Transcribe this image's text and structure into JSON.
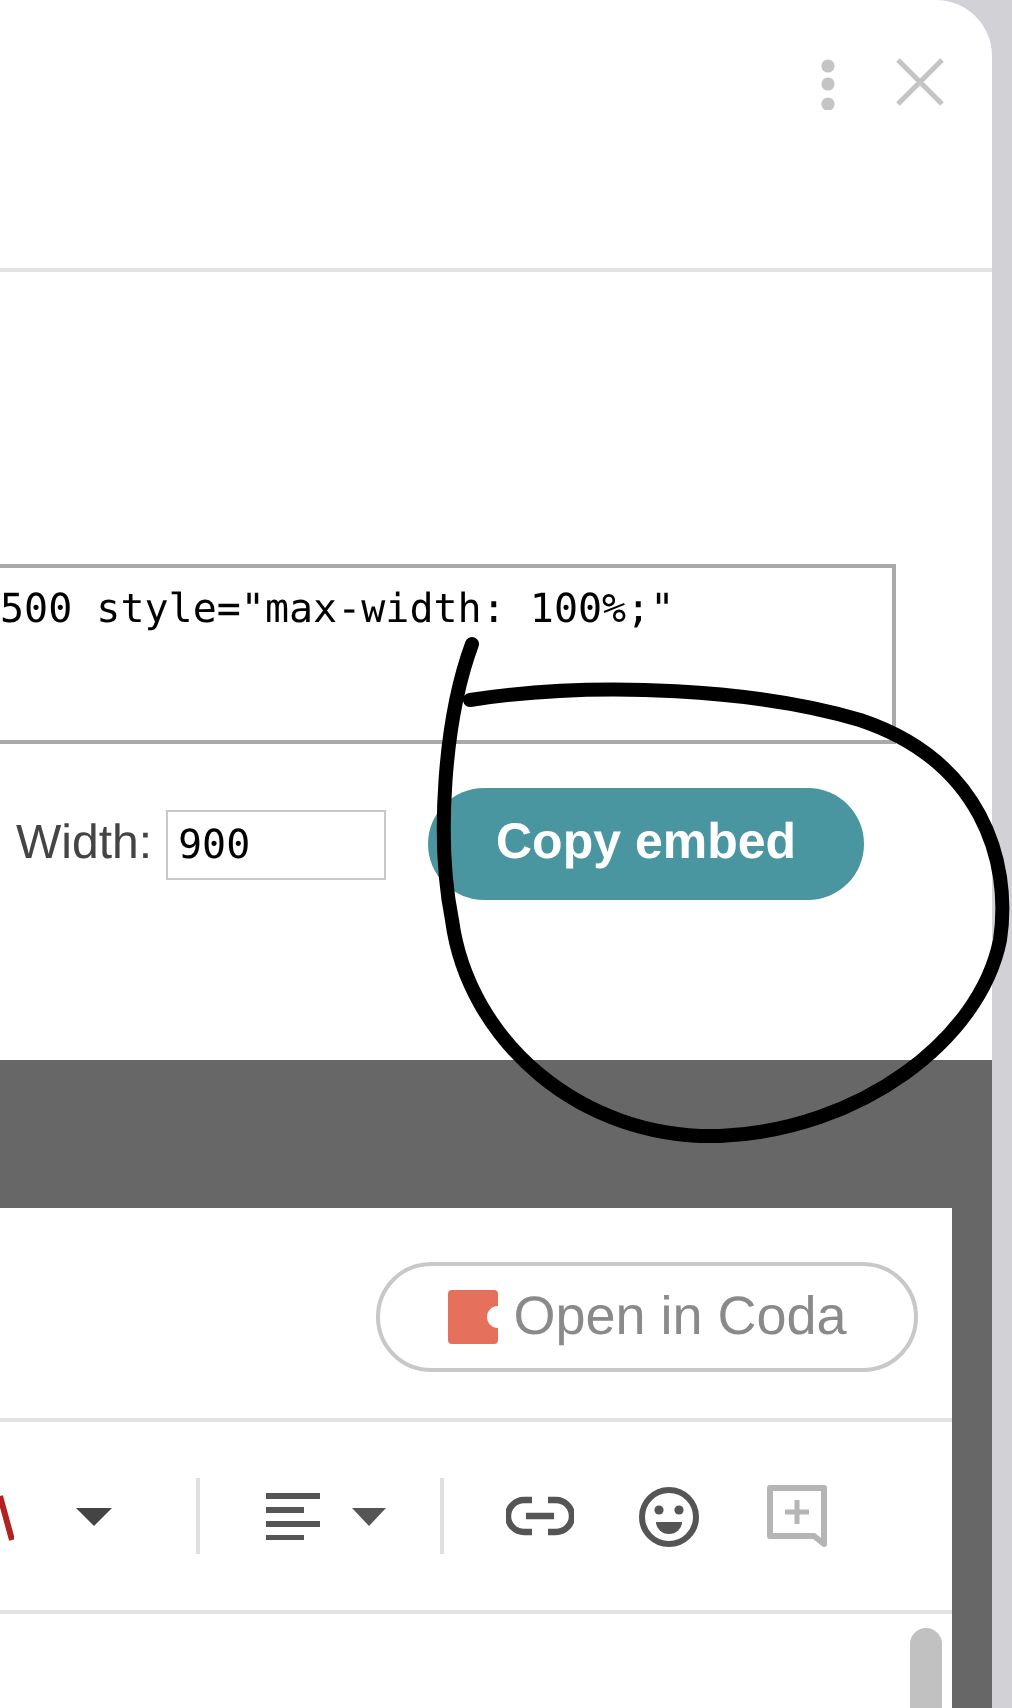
{
  "dialog": {
    "embed_code": "500 style=\"max-width: 100%;\"",
    "width_label": "Width:",
    "width_value": "900",
    "copy_button": "Copy embed"
  },
  "embed_preview": {
    "open_button": "Open in Coda"
  }
}
